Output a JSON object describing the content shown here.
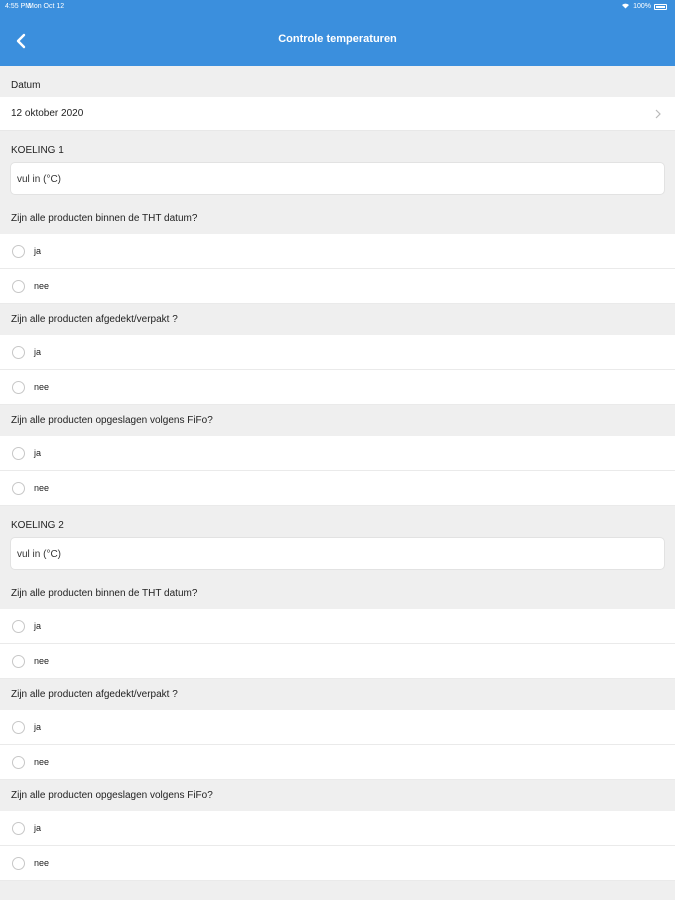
{
  "status_bar": {
    "time": "4:55 PM",
    "date": "Mon Oct 12",
    "battery": "100%"
  },
  "header": {
    "title": "Controle temperaturen",
    "back_icon": "chevron-left-icon",
    "color": "#3b8fdd"
  },
  "date_section": {
    "label": "Datum",
    "value": "12 oktober 2020"
  },
  "groups": [
    {
      "label": "KOELING 1",
      "placeholder": "vul in (°C)",
      "questions": [
        {
          "text": "Zijn alle producten binnen de THT datum?",
          "options": [
            "ja",
            "nee"
          ]
        },
        {
          "text": "Zijn alle producten afgedekt/verpakt ?",
          "options": [
            "ja",
            "nee"
          ]
        },
        {
          "text": "Zijn alle producten opgeslagen volgens FiFo?",
          "options": [
            "ja",
            "nee"
          ]
        }
      ]
    },
    {
      "label": "KOELING 2",
      "placeholder": "vul in (°C)",
      "questions": [
        {
          "text": "Zijn alle producten binnen de THT datum?",
          "options": [
            "ja",
            "nee"
          ]
        },
        {
          "text": "Zijn alle producten afgedekt/verpakt ?",
          "options": [
            "ja",
            "nee"
          ]
        },
        {
          "text": "Zijn alle producten opgeslagen volgens FiFo?",
          "options": [
            "ja",
            "nee"
          ]
        }
      ]
    }
  ]
}
